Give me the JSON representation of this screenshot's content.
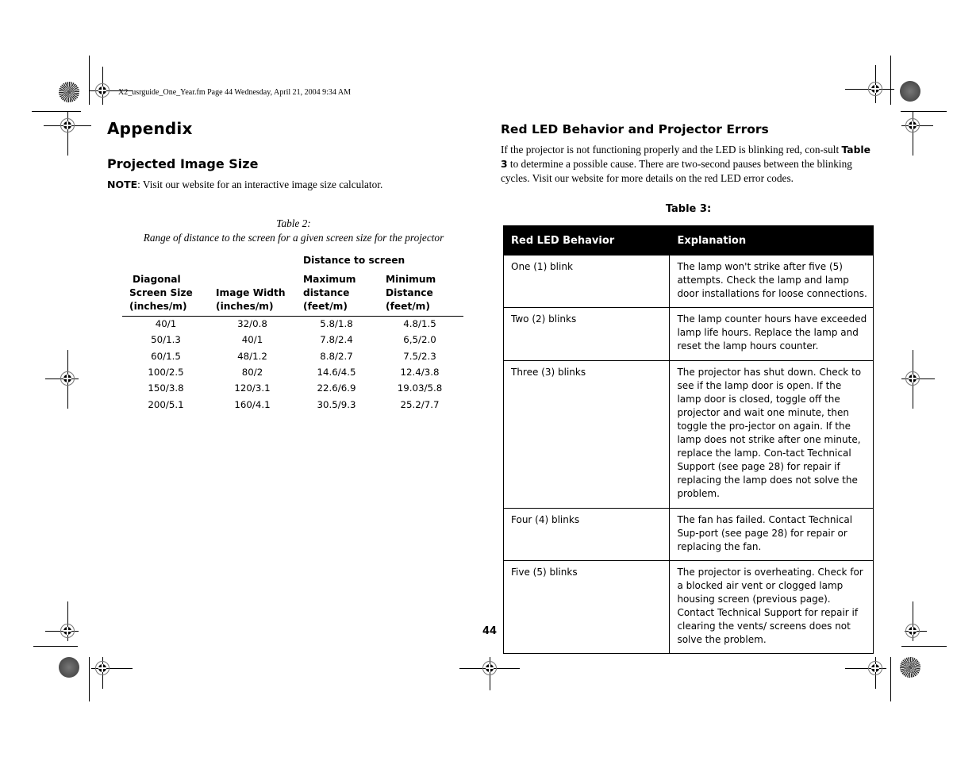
{
  "slug": "X2_usrguide_One_Year.fm  Page 44  Wednesday, April 21, 2004  9:34 AM",
  "left": {
    "title": "Appendix",
    "section_title": "Projected Image Size",
    "note_label": "NOTE",
    "note_text": ": Visit our website for an interactive image size calculator.",
    "table2": {
      "caption_line1": "Table 2:",
      "caption_line2": "Range of distance to the screen for a given screen size for the projector",
      "group_header": "Distance to screen",
      "headers": [
        [
          "Diagonal",
          "Screen Size",
          "(inches/m)"
        ],
        [
          "Image Width",
          "(inches/m)"
        ],
        [
          "Maximum",
          "distance",
          "(feet/m)"
        ],
        [
          "Minimum",
          "Distance",
          "(feet/m)"
        ]
      ],
      "rows": [
        [
          "40/1",
          "32/0.8",
          "5.8/1.8",
          "4.8/1.5"
        ],
        [
          "50/1.3",
          "40/1",
          "7.8/2.4",
          "6,5/2.0"
        ],
        [
          "60/1.5",
          "48/1.2",
          "8.8/2.7",
          "7.5/2.3"
        ],
        [
          "100/2.5",
          "80/2",
          "14.6/4.5",
          "12.4/3.8"
        ],
        [
          "150/3.8",
          "120/3.1",
          "22.6/6.9",
          "19.03/5.8"
        ],
        [
          "200/5.1",
          "160/4.1",
          "30.5/9.3",
          "25.2/7.7"
        ]
      ]
    }
  },
  "right": {
    "section_title": "Red LED Behavior and Projector Errors",
    "para_before": "If the projector is not functioning properly and the LED is blinking red, con-sult ",
    "para_ref": "Table 3",
    "para_after": " to determine a possible cause. There are two-second pauses between the blinking cycles. Visit our website for more details on the red LED error codes.",
    "table3": {
      "caption": "Table 3:",
      "headers": [
        "Red LED Behavior",
        "Explanation"
      ],
      "rows": [
        [
          "One (1) blink",
          "The lamp won't strike after five (5) attempts. Check the lamp and lamp door installations for loose connections."
        ],
        [
          "Two (2) blinks",
          "The lamp counter hours have exceeded lamp life hours. Replace the lamp and reset the lamp hours counter."
        ],
        [
          "Three (3) blinks",
          "The projector has shut down. Check to see if the lamp door is open. If the lamp door is closed, toggle off the projector and wait one minute, then toggle the pro-jector on again. If the lamp does not strike after one minute, replace the lamp. Con-tact Technical Support (see page 28) for repair if replacing the lamp does not solve the problem."
        ],
        [
          "Four (4) blinks",
          "The fan has failed. Contact Technical Sup-port (see page 28) for repair or replacing the fan."
        ],
        [
          "Five (5) blinks",
          "The projector is overheating. Check for a blocked air vent or clogged lamp housing screen (previous page). Contact Technical Support for repair if clearing the vents/ screens does not solve the problem."
        ]
      ]
    }
  },
  "page_number": "44"
}
